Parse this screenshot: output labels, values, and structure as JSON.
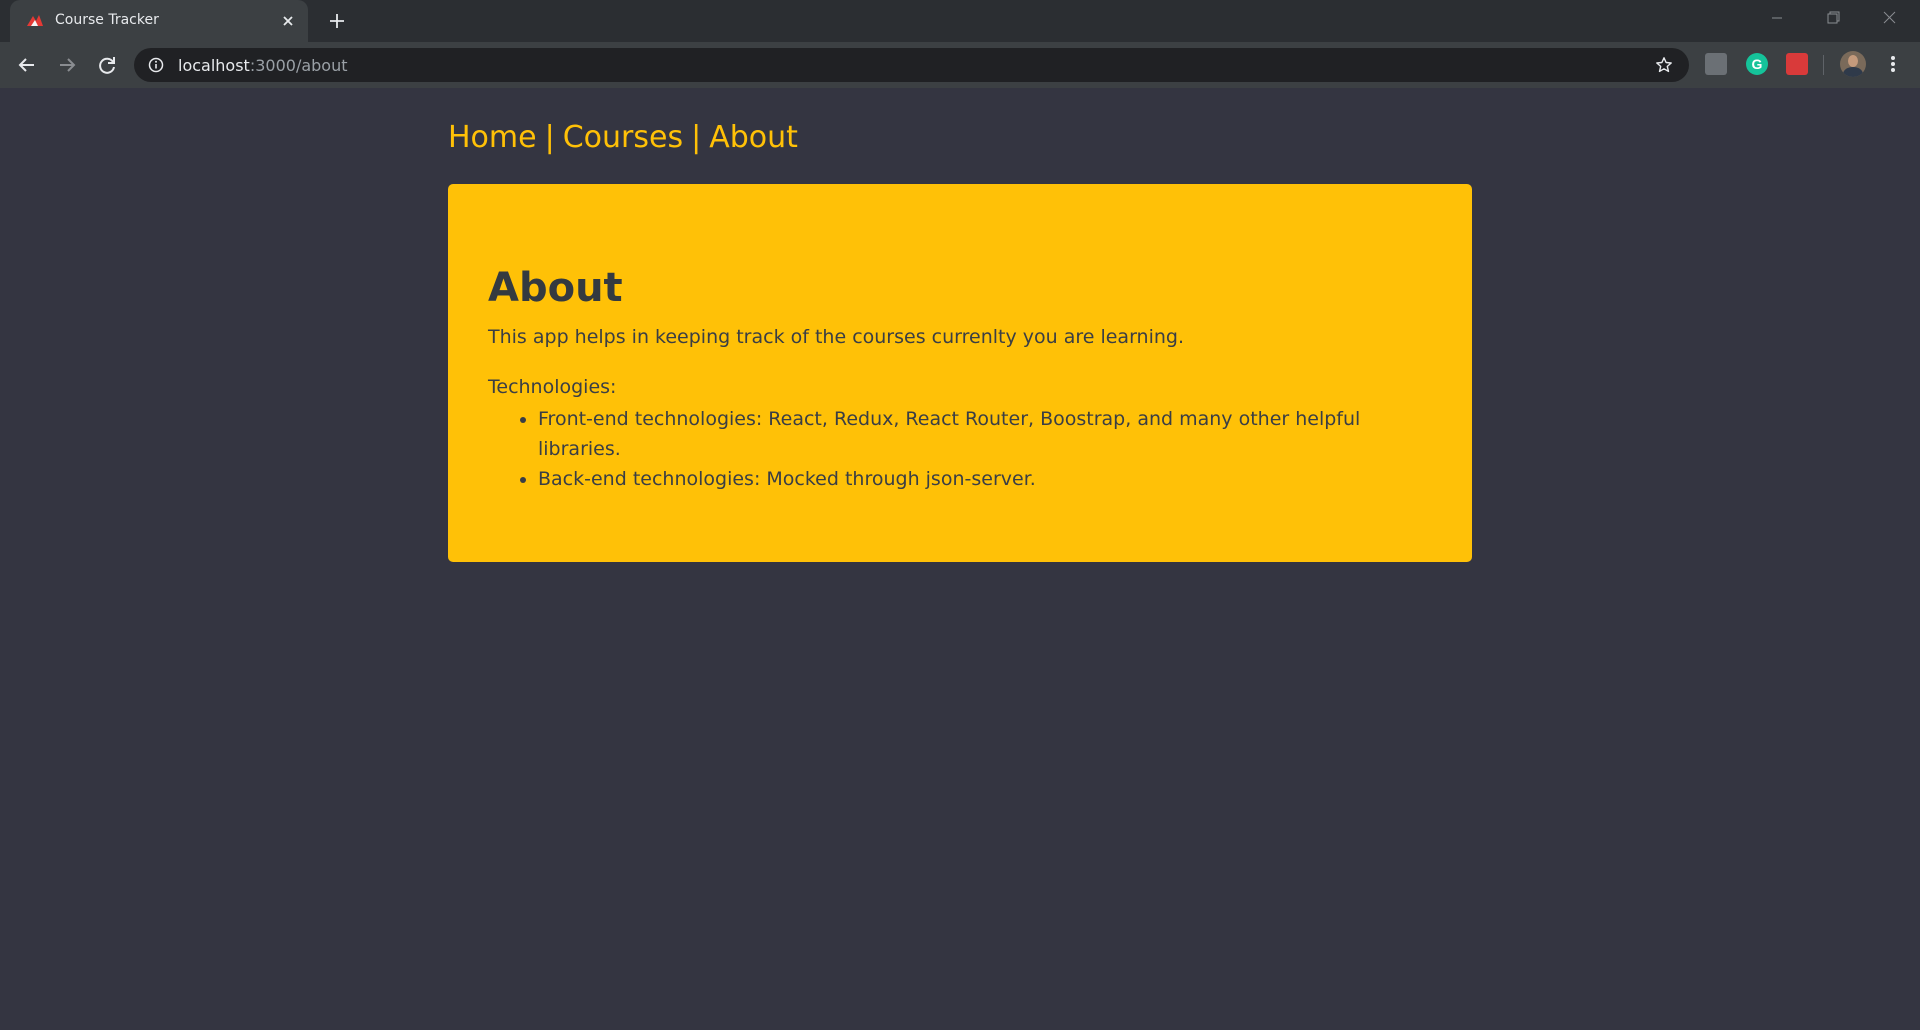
{
  "browser": {
    "tab_title": "Course Tracker",
    "url_host": "localhost",
    "url_path": ":3000/about",
    "extensions": [
      "extension-icon",
      "grammarly-icon",
      "red-extension-icon"
    ]
  },
  "nav": {
    "home": "Home",
    "courses": "Courses",
    "about": "About",
    "separator": "|"
  },
  "about": {
    "heading": "About",
    "description": "This app helps in keeping track of the courses currenlty you are learning.",
    "tech_label": "Technologies:",
    "technologies": [
      "Front-end technologies: React, Redux, React Router, Boostrap, and many other helpful libraries.",
      "Back-end technologies: Mocked through json-server."
    ]
  },
  "colors": {
    "page_bg": "#343541",
    "accent": "#ffc107",
    "text_dark": "#343a40"
  }
}
